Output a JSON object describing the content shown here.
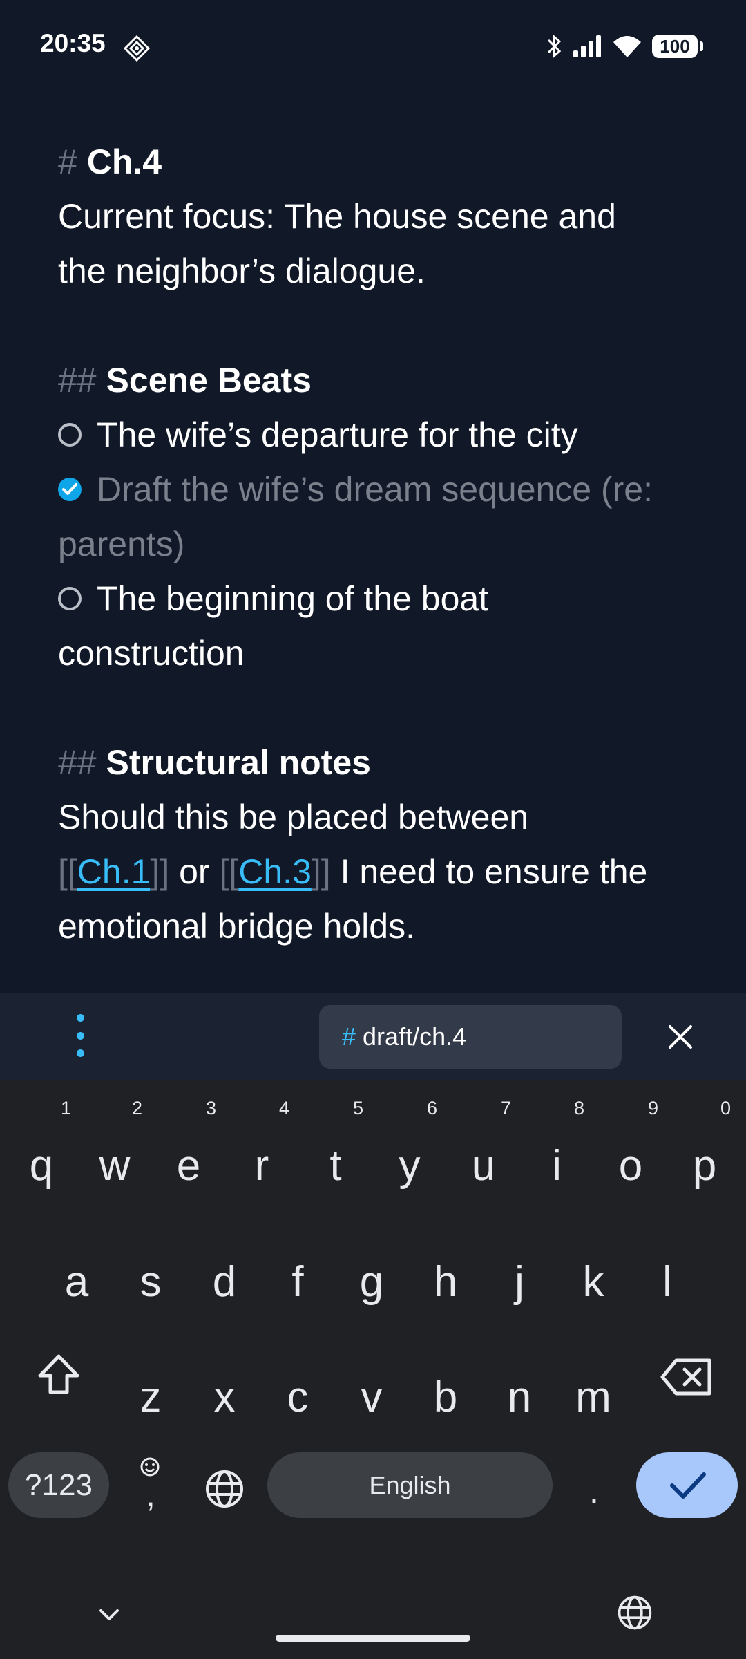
{
  "status_bar": {
    "time": "20:35",
    "battery": "100"
  },
  "note": {
    "heading1": {
      "marker": "#",
      "text": "Ch.4"
    },
    "focus_line1": "Current focus: The house scene and",
    "focus_line2": "the neighbor’s dialogue.",
    "heading2": {
      "marker": "##",
      "text": "Scene Beats"
    },
    "tasks": [
      {
        "line1": "The wife’s departure for the city",
        "done": false
      },
      {
        "line1": "Draft the wife’s dream sequence (re:",
        "line2": "parents)",
        "done": true
      },
      {
        "line1": "The beginning of the boat",
        "line2": "construction",
        "done": false
      }
    ],
    "heading3": {
      "marker": "##",
      "text": "Structural notes"
    },
    "notes_line1": "Should this be placed between",
    "link_open": "[[",
    "link_close": "]]",
    "link1": "Ch.1",
    "or_text": " or ",
    "link2": "Ch.3",
    "notes_after": " I need to ensure the",
    "notes_line3": "emotional bridge holds."
  },
  "toolbar": {
    "tag_hash": "#",
    "tag": "draft/ch.4"
  },
  "keyboard": {
    "row1": [
      "q",
      "w",
      "e",
      "r",
      "t",
      "y",
      "u",
      "i",
      "o",
      "p"
    ],
    "row1_numbers": [
      "1",
      "2",
      "3",
      "4",
      "5",
      "6",
      "7",
      "8",
      "9",
      "0"
    ],
    "row2": [
      "a",
      "s",
      "d",
      "f",
      "g",
      "h",
      "j",
      "k",
      "l"
    ],
    "row3": [
      "z",
      "x",
      "c",
      "v",
      "b",
      "n",
      "m"
    ],
    "symbols_key": "?123",
    "comma": ",",
    "space_label": "English",
    "period": ".",
    "accent": "#a8c7fa",
    "icons": [
      "shift-icon",
      "backspace-icon",
      "emoji-icon",
      "globe-icon",
      "check-icon",
      "chevron-down-icon"
    ]
  },
  "colors": {
    "background": "#111827",
    "link": "#38bdf8",
    "toolbar": "#1b2333",
    "keyboard": "#202124"
  }
}
